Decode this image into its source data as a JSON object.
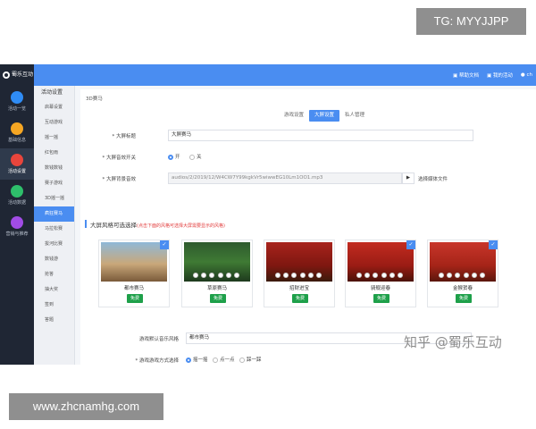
{
  "watermarks": {
    "top": "TG: MYYJJPP",
    "bottom": "www.zhcnamhg.com",
    "zhihu": "知乎 @蜀乐互动"
  },
  "logo": {
    "text": "蜀乐互动"
  },
  "topnav": {
    "help": "帮助文档",
    "mine": "我的活动",
    "user": "ch"
  },
  "rail": [
    {
      "label": "活动一览",
      "color": "#2f8cf5"
    },
    {
      "label": "基础信息",
      "color": "#f5a623"
    },
    {
      "label": "活动设置",
      "color": "#e8453c"
    },
    {
      "label": "活动数据",
      "color": "#2ebf6b"
    },
    {
      "label": "营销与推荐",
      "color": "#a14ce6"
    }
  ],
  "submenu": {
    "title": "活动设置",
    "items": [
      "启幕设置",
      "互动游戏",
      "摇一摇",
      "红包雨",
      "数钱数钱",
      "赛子游戏",
      "3D摇一摇",
      "疯狂赛马",
      "马拉松赛",
      "拔河比赛",
      "数钱游",
      "抢答",
      "抽大奖",
      "签到",
      "答题"
    ]
  },
  "main": {
    "breadcrumb": "3D赛马",
    "tabs": [
      "游戏设置",
      "大屏设置",
      "私人管理"
    ],
    "screen_title_label": "* 大屏标题",
    "screen_title_value": "大屏赛马",
    "music_switch_label": "* 大屏音效开关",
    "music_on": "开",
    "music_off": "关",
    "music_file_label": "* 大屏背景音效",
    "music_file_value": "audios/2/2019/12/W4CW7Y99kgkVr5wiwwEG10Lm1OO1.mp3",
    "music_pick": "选择媒体文件",
    "style_section": "大屏风格可选选择",
    "style_hint": "(点击下面的风格可选择大屏需要显示的风格)",
    "themes": [
      {
        "name": "都市赛马",
        "use": "免费"
      },
      {
        "name": "草原赛马",
        "use": "免费"
      },
      {
        "name": "招财进宝",
        "use": "免费"
      },
      {
        "name": "骑舰迎春",
        "use": "免费"
      },
      {
        "name": "金猴贺春",
        "use": "免费"
      }
    ],
    "music_style_label": "游戏默认音乐风格",
    "music_style_value": "都市赛马",
    "play_mode_label": "* 游戏游戏方式选择",
    "play_modes": [
      "摇一摇",
      "点一点",
      "踩一踩"
    ]
  },
  "colors": {
    "accent": "#4a8df1",
    "rail": "#1f2634",
    "free_button": "#1ea04a"
  }
}
